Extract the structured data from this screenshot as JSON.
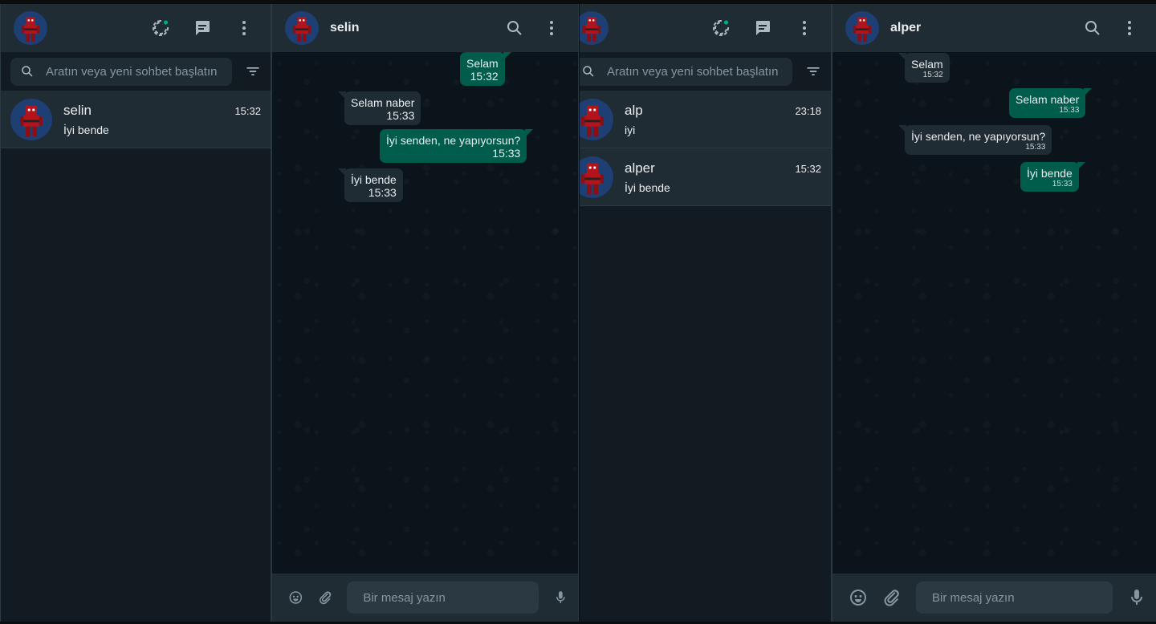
{
  "windows": [
    {
      "sidebar": {
        "search_placeholder": "Aratın veya yeni sohbet başlatın",
        "chats": [
          {
            "name": "selin",
            "time": "15:32",
            "preview": "İyi bende"
          }
        ]
      },
      "chat": {
        "title": "selin",
        "messages": [
          {
            "direction": "out",
            "text": "Selam",
            "time": "15:32"
          },
          {
            "direction": "in",
            "text": "Selam naber",
            "time": "15:33"
          },
          {
            "direction": "out",
            "text": "İyi senden, ne yapıyorsun?",
            "time": "15:33"
          },
          {
            "direction": "in",
            "text": "İyi bende",
            "time": "15:33"
          }
        ],
        "composer_placeholder": "Bir mesaj yazın"
      }
    },
    {
      "sidebar": {
        "search_placeholder": "Aratın veya yeni sohbet başlatın",
        "chats": [
          {
            "name": "alp",
            "time": "23:18",
            "preview": "iyi"
          },
          {
            "name": "alper",
            "time": "15:32",
            "preview": "İyi bende"
          }
        ]
      },
      "chat": {
        "title": "alper",
        "messages": [
          {
            "direction": "in",
            "text": "Selam",
            "time": "15:32"
          },
          {
            "direction": "out",
            "text": "Selam naber",
            "time": "15:33"
          },
          {
            "direction": "in",
            "text": "İyi senden, ne yapıyorsun?",
            "time": "15:33"
          },
          {
            "direction": "out",
            "text": "İyi bende",
            "time": "15:33"
          }
        ],
        "composer_placeholder": "Bir mesaj yazın"
      }
    }
  ],
  "icons": {
    "status": "status-icon",
    "new_chat": "new-chat-icon",
    "menu": "menu-dots-icon",
    "search": "search-icon",
    "filter": "filter-icon",
    "emoji": "emoji-icon",
    "attach": "attach-icon",
    "mic": "mic-icon"
  },
  "colors": {
    "panel": "#202c33",
    "background": "#111b21",
    "outgoing_bubble": "#005c4b",
    "incoming_bubble": "#202c33",
    "accent": "#00a884"
  }
}
